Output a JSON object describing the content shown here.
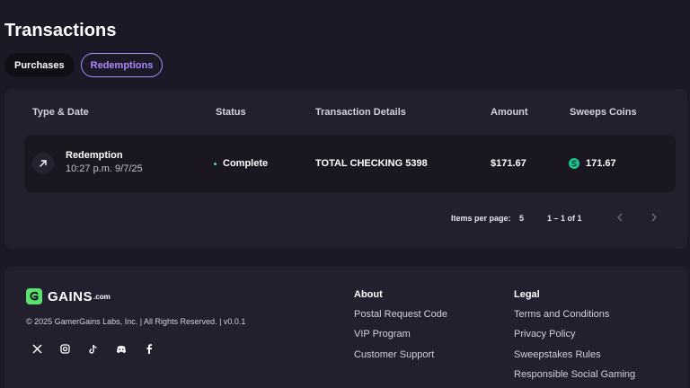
{
  "page": {
    "title": "Transactions"
  },
  "tabs": [
    {
      "label": "Purchases",
      "active": false
    },
    {
      "label": "Redemptions",
      "active": true
    }
  ],
  "table": {
    "columns": [
      "Type & Date",
      "Status",
      "Transaction Details",
      "Amount",
      "Sweeps Coins"
    ],
    "rows": [
      {
        "type": "Redemption",
        "date": "10:27 p.m. 9/7/25",
        "status": "Complete",
        "details": "TOTAL CHECKING 5398",
        "amount": "$171.67",
        "sweeps_coins": "171.67",
        "type_icon": "arrow-up-right-icon",
        "coin_icon": "sweeps-coin-icon"
      }
    ]
  },
  "pagination": {
    "items_per_page_label": "Items per page:",
    "items_per_page_value": "5",
    "range": "1 – 1 of 1"
  },
  "footer": {
    "logo_text": "GAINS",
    "logo_suffix": ".com",
    "copyright": "© 2025 GamerGains Labs, Inc. | All Rights Reserved. | v0.0.1",
    "social_icons": [
      "x-icon",
      "instagram-icon",
      "tiktok-icon",
      "discord-icon",
      "facebook-icon"
    ],
    "about": {
      "heading": "About",
      "links": [
        "Postal Request Code",
        "VIP Program",
        "Customer Support"
      ]
    },
    "legal": {
      "heading": "Legal",
      "links": [
        "Terms and Conditions",
        "Privacy Policy",
        "Sweepstakes Rules",
        "Responsible Social Gaming"
      ]
    }
  },
  "colors": {
    "background": "#1b1925",
    "card": "#231f2f",
    "row": "#1a1722",
    "accent": "#a98cff",
    "status_complete": "#4be39b",
    "coin": "#18c38c",
    "logo": "#56e36e"
  }
}
